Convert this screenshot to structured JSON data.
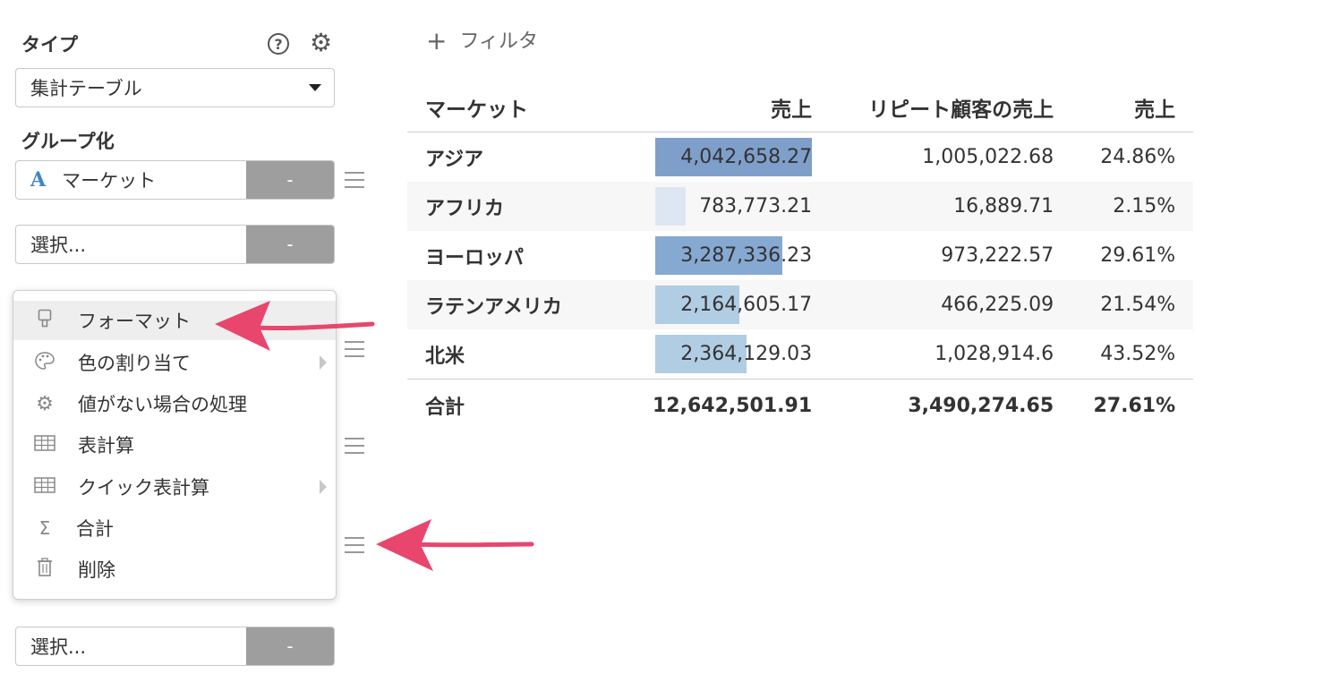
{
  "sidebar": {
    "type_label": "タイプ",
    "type_select_value": "集計テーブル",
    "help_label": "?",
    "group_label": "グループ化",
    "group_field": {
      "type_glyph": "A",
      "value": "マーケット",
      "button_label": "-"
    },
    "select_fields": [
      {
        "placeholder": "選択...",
        "button_label": "-"
      },
      {
        "placeholder": "選択...",
        "button_label": "-"
      }
    ]
  },
  "context_menu": {
    "items": [
      {
        "icon": "paint-brush-icon",
        "label": "フォーマット",
        "has_submenu": false,
        "highlighted": true
      },
      {
        "icon": "palette-icon",
        "label": "色の割り当て",
        "has_submenu": true,
        "highlighted": false
      },
      {
        "icon": "gear-icon",
        "label": "値がない場合の処理",
        "has_submenu": false,
        "highlighted": false
      },
      {
        "icon": "table-icon",
        "label": "表計算",
        "has_submenu": false,
        "highlighted": false
      },
      {
        "icon": "table-icon",
        "label": "クイック表計算",
        "has_submenu": true,
        "highlighted": false
      },
      {
        "icon": "sigma-icon",
        "label": "合計",
        "has_submenu": false,
        "highlighted": false
      },
      {
        "icon": "trash-icon",
        "label": "削除",
        "has_submenu": false,
        "highlighted": false
      }
    ]
  },
  "filter": {
    "plus": "+",
    "label": "フィルタ"
  },
  "table": {
    "headers": [
      "マーケット",
      "売上",
      "リピート顧客の売上",
      "売上"
    ],
    "rows": [
      {
        "market": "アジア",
        "sales": "4,042,658.27",
        "sales_value": 4042658.27,
        "repeat_sales": "1,005,022.68",
        "percent": "24.86%",
        "bar_color": "#7f9fcb"
      },
      {
        "market": "アフリカ",
        "sales": "783,773.21",
        "sales_value": 783773.21,
        "repeat_sales": "16,889.71",
        "percent": "2.15%",
        "bar_color": "#dde7f3"
      },
      {
        "market": "ヨーロッパ",
        "sales": "3,287,336.23",
        "sales_value": 3287336.23,
        "repeat_sales": "973,222.57",
        "percent": "29.61%",
        "bar_color": "#86a9d2"
      },
      {
        "market": "ラテンアメリカ",
        "sales": "2,164,605.17",
        "sales_value": 2164605.17,
        "repeat_sales": "466,225.09",
        "percent": "21.54%",
        "bar_color": "#b1cde4"
      },
      {
        "market": "北米",
        "sales": "2,364,129.03",
        "sales_value": 2364129.03,
        "repeat_sales": "1,028,914.6",
        "percent": "43.52%",
        "bar_color": "#b1cde4"
      }
    ],
    "total": {
      "label": "合計",
      "sales": "12,642,501.91",
      "repeat_sales": "3,490,274.65",
      "percent": "27.61%"
    }
  },
  "colors": {
    "annotation_arrow": "#e8466d",
    "field_button": "#9e9e9e",
    "type_glyph": "#3d87c7"
  }
}
